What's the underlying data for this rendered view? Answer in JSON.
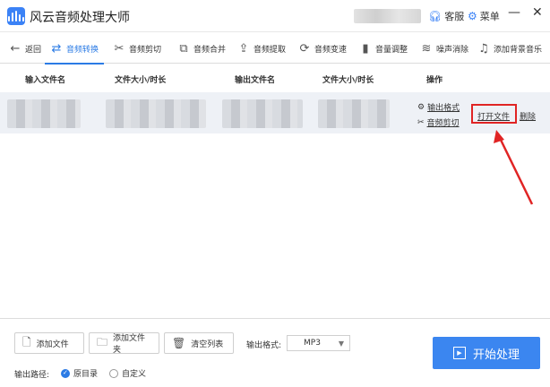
{
  "app": {
    "title": "风云音频处理大师",
    "service_label": "客服",
    "menu_label": "菜单"
  },
  "toolbar": {
    "back": "返回",
    "tools": [
      {
        "label": "音频转换",
        "icon": "convert-icon"
      },
      {
        "label": "音频剪切",
        "icon": "scissors-icon"
      },
      {
        "label": "音频合并",
        "icon": "merge-icon"
      },
      {
        "label": "音频提取",
        "icon": "extract-icon"
      },
      {
        "label": "音频变速",
        "icon": "speed-icon"
      },
      {
        "label": "音量调整",
        "icon": "volume-icon"
      },
      {
        "label": "噪声消除",
        "icon": "noise-icon"
      },
      {
        "label": "添加背景音乐",
        "icon": "music-icon"
      }
    ]
  },
  "table": {
    "headers": [
      "输入文件名",
      "文件大小/时长",
      "输出文件名",
      "文件大小/时长",
      "操作"
    ],
    "row": {
      "output_format": "输出格式",
      "audio_cut": "音频剪切",
      "open_file": "打开文件",
      "delete": "删除"
    }
  },
  "bottom": {
    "add_file": "添加文件",
    "add_folder": "添加文件夹",
    "clear_list": "清空列表",
    "format_label": "输出格式:",
    "format_value": "MP3",
    "path_label": "输出路径:",
    "path_original": "原目录",
    "path_custom": "自定义",
    "start": "开始处理"
  },
  "colors": {
    "accent": "#2b7be5",
    "highlight": "#e02424"
  }
}
